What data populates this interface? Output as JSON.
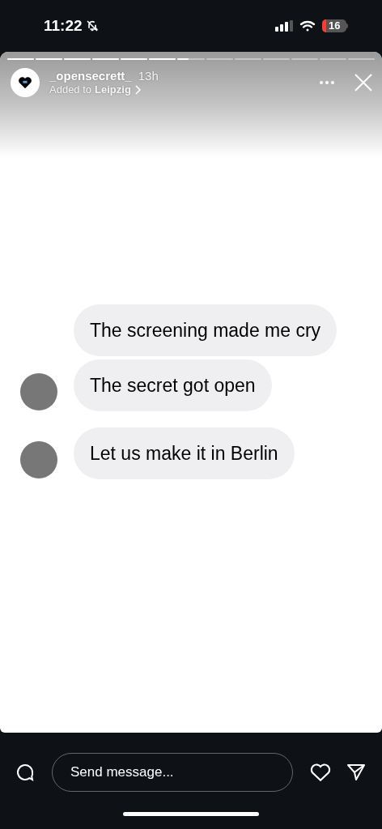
{
  "status_bar": {
    "time": "11:22",
    "battery": "16"
  },
  "story": {
    "progress": [
      {
        "level": 1
      },
      {
        "level": 1
      },
      {
        "level": 1
      },
      {
        "level": 1
      },
      {
        "level": 1
      },
      {
        "level": 1
      },
      {
        "level": 0.4
      },
      {
        "level": 0
      },
      {
        "level": 0
      },
      {
        "level": 0
      },
      {
        "level": 0
      },
      {
        "level": 0
      },
      {
        "level": 0
      }
    ],
    "username": "_opensecrett_",
    "age": "13h",
    "added_prefix": "Added to",
    "added_place": "Leipzig",
    "messages": [
      {
        "text": "The screening made me cry",
        "avatar": false
      },
      {
        "text": "The secret got open",
        "avatar": true
      },
      {
        "text": "Let us make it in Berlin",
        "avatar": true
      }
    ]
  },
  "reply_bar": {
    "placeholder": "Send message..."
  }
}
